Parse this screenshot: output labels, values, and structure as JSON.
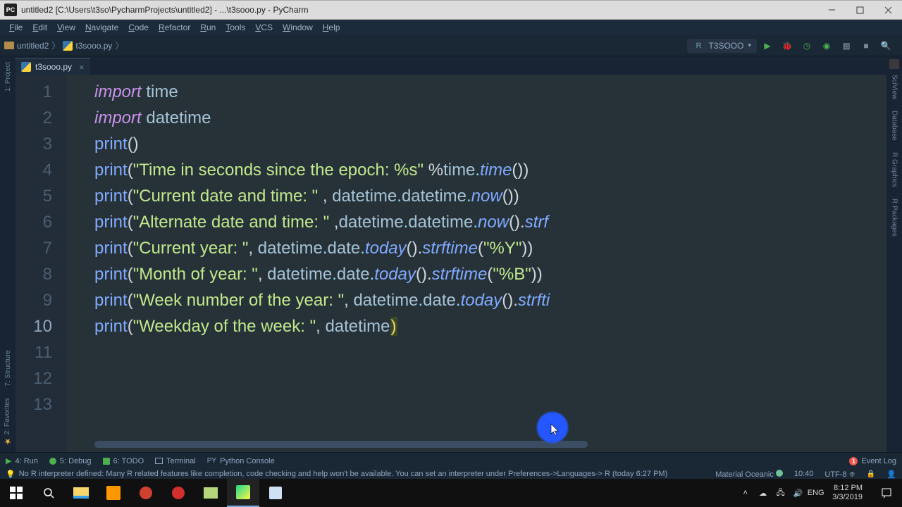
{
  "window": {
    "title": "untitled2 [C:\\Users\\t3so\\PycharmProjects\\untitled2] - ...\\t3sooo.py - PyCharm"
  },
  "menu": [
    "File",
    "Edit",
    "View",
    "Navigate",
    "Code",
    "Refactor",
    "Run",
    "Tools",
    "VCS",
    "Window",
    "Help"
  ],
  "breadcrumb": {
    "project": "untitled2",
    "file": "t3sooo.py"
  },
  "run_config": {
    "name": "T3SOOO"
  },
  "tabs": [
    {
      "label": "t3sooo.py",
      "icon": "python"
    }
  ],
  "left_tools": [
    "1: Project",
    "7: Structure",
    "2: Favorites"
  ],
  "right_tools": [
    "SciView",
    "Database",
    "R Graphics",
    "R Packages"
  ],
  "code": {
    "lines": [
      {
        "n": 1,
        "pre": "",
        "tokens": [
          [
            "kw",
            "import "
          ],
          [
            "id",
            "time"
          ]
        ]
      },
      {
        "n": 2,
        "pre": "",
        "tokens": [
          [
            "kw",
            "import "
          ],
          [
            "id",
            "datetime"
          ]
        ]
      },
      {
        "n": 3,
        "pre": "",
        "tokens": [
          [
            "fn",
            "print"
          ],
          [
            "pun",
            "()"
          ]
        ]
      },
      {
        "n": 4,
        "pre": "",
        "tokens": [
          [
            "fn",
            "print"
          ],
          [
            "pun",
            "("
          ],
          [
            "str",
            "\"Time in seconds since the epoch: %s\""
          ],
          [
            "pun",
            " %"
          ],
          [
            "id",
            "time"
          ],
          [
            "op",
            "."
          ],
          [
            "call",
            "time"
          ],
          [
            "pun",
            "())"
          ]
        ]
      },
      {
        "n": 5,
        "pre": "",
        "tokens": [
          [
            "fn",
            "print"
          ],
          [
            "pun",
            "("
          ],
          [
            "str",
            "\"Current date and time: \""
          ],
          [
            "pun",
            " , "
          ],
          [
            "id",
            "datetime"
          ],
          [
            "op",
            "."
          ],
          [
            "id",
            "datetime"
          ],
          [
            "op",
            "."
          ],
          [
            "call",
            "now"
          ],
          [
            "pun",
            "())"
          ]
        ]
      },
      {
        "n": 6,
        "pre": "",
        "tokens": [
          [
            "fn",
            "print"
          ],
          [
            "pun",
            "("
          ],
          [
            "str",
            "\"Alternate date and time: \""
          ],
          [
            "pun",
            " ,"
          ],
          [
            "id",
            "datetime"
          ],
          [
            "op",
            "."
          ],
          [
            "id",
            "datetime"
          ],
          [
            "op",
            "."
          ],
          [
            "call",
            "now"
          ],
          [
            "pun",
            "()."
          ],
          [
            "call",
            "strf"
          ]
        ]
      },
      {
        "n": 7,
        "pre": "",
        "tokens": [
          [
            "fn",
            "print"
          ],
          [
            "pun",
            "("
          ],
          [
            "str",
            "\"Current year: \""
          ],
          [
            "pun",
            ", "
          ],
          [
            "id",
            "datetime"
          ],
          [
            "op",
            "."
          ],
          [
            "id",
            "date"
          ],
          [
            "op",
            "."
          ],
          [
            "call",
            "today"
          ],
          [
            "pun",
            "()."
          ],
          [
            "call",
            "strftime"
          ],
          [
            "pun",
            "("
          ],
          [
            "str",
            "\"%Y\""
          ],
          [
            "pun",
            "))"
          ]
        ]
      },
      {
        "n": 8,
        "pre": "",
        "tokens": [
          [
            "fn",
            "print"
          ],
          [
            "pun",
            "("
          ],
          [
            "str",
            "\"Month of year: \""
          ],
          [
            "pun",
            ", "
          ],
          [
            "id",
            "datetime"
          ],
          [
            "op",
            "."
          ],
          [
            "id",
            "date"
          ],
          [
            "op",
            "."
          ],
          [
            "call",
            "today"
          ],
          [
            "pun",
            "()."
          ],
          [
            "call",
            "strftime"
          ],
          [
            "pun",
            "("
          ],
          [
            "str",
            "\"%B\""
          ],
          [
            "pun",
            "))"
          ]
        ]
      },
      {
        "n": 9,
        "pre": "",
        "tokens": [
          [
            "fn",
            "print"
          ],
          [
            "pun",
            "("
          ],
          [
            "str",
            "\"Week number of the year: \""
          ],
          [
            "pun",
            ", "
          ],
          [
            "id",
            "datetime"
          ],
          [
            "op",
            "."
          ],
          [
            "id",
            "date"
          ],
          [
            "op",
            "."
          ],
          [
            "call",
            "today"
          ],
          [
            "pun",
            "()."
          ],
          [
            "call",
            "strfti"
          ]
        ]
      },
      {
        "n": 10,
        "pre": "",
        "tokens": [
          [
            "fn",
            "print"
          ],
          [
            "pun",
            "("
          ],
          [
            "str",
            "\"Weekday of the week: \""
          ],
          [
            "pun",
            ", "
          ],
          [
            "id",
            "datetime"
          ],
          [
            "hl",
            ")"
          ]
        ]
      },
      {
        "n": 11,
        "pre": "",
        "tokens": []
      },
      {
        "n": 12,
        "pre": "",
        "tokens": []
      },
      {
        "n": 13,
        "pre": "",
        "tokens": []
      }
    ],
    "current_line": 10
  },
  "bottom_tools": {
    "run": "4: Run",
    "debug": "5: Debug",
    "todo": "6: TODO",
    "terminal": "Terminal",
    "python_console": "Python Console",
    "event_log": "Event Log"
  },
  "status": {
    "message": "No R interpreter defined: Many R related features like completion, code checking and help won't be available. You can set an interpreter under Preferences->Languages-> R (today 6:27 PM)",
    "theme": "Material Oceanic",
    "cursor": "10:40",
    "encoding": "UTF-8"
  },
  "taskbar": {
    "tray": {
      "ime": "ENG",
      "time": "8:12 PM",
      "date": "3/3/2019"
    }
  }
}
